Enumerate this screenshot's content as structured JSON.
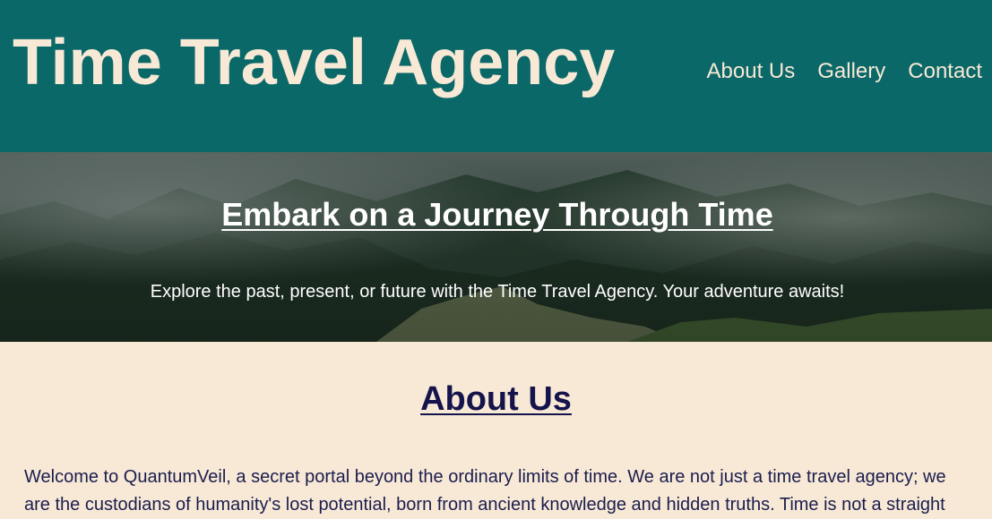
{
  "header": {
    "title": "Time Travel Agency",
    "nav": [
      {
        "label": "About Us"
      },
      {
        "label": "Gallery"
      },
      {
        "label": "Contact"
      }
    ]
  },
  "hero": {
    "title": "Embark on a Journey Through Time",
    "subtitle": "Explore the past, present, or future with the Time Travel Agency. Your adventure awaits!"
  },
  "about": {
    "heading": "About Us",
    "text": "Welcome to QuantumVeil, a secret portal beyond the ordinary limits of time. We are not just a time travel agency; we are the custodians of humanity's lost potential, born from ancient knowledge and hidden truths. Time is not a straight"
  },
  "colors": {
    "header_bg": "#0b6868",
    "cream": "#f8e9d6",
    "heading_navy": "#14134c"
  }
}
